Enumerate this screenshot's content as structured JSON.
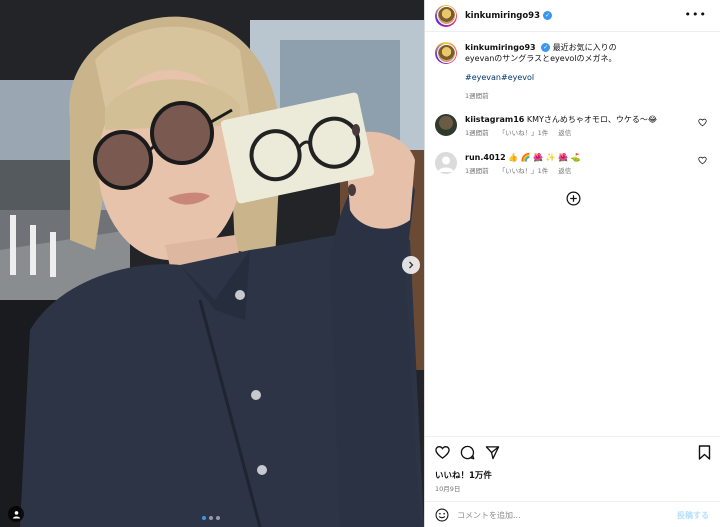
{
  "post": {
    "username": "kinkumiringo93",
    "verified_mark": "✓",
    "more_icon": "more-horizontal-icon",
    "caption": {
      "text_line1": "最近お気に入りの",
      "text_line2": "eyevanのサングラスとeyevolのメガネ。",
      "hashtags": "#eyevan#eyevol",
      "time": "1週間前"
    },
    "comments": [
      {
        "username": "kiistagram16",
        "text": "KMYさんめちゃオモロ、ウケる～😂",
        "time": "1週間前",
        "likes": "「いいね！」1件",
        "reply": "返信"
      },
      {
        "username": "run.4012",
        "text": "👍 🌈 🌺 ✨ 🌺 ⛳",
        "time": "1週間前",
        "likes": "「いいね！」1件",
        "reply": "返信"
      }
    ],
    "likes": "いいね！1万件",
    "date": "10月9日",
    "comment_placeholder": "コメントを追加...",
    "post_button": "投稿する"
  },
  "carousel": {
    "slides": 3,
    "active_index": 0
  },
  "colors": {
    "accent": "#3897f0",
    "hashtag": "#00376b",
    "muted": "#737373",
    "border": "#dbdbdb"
  }
}
